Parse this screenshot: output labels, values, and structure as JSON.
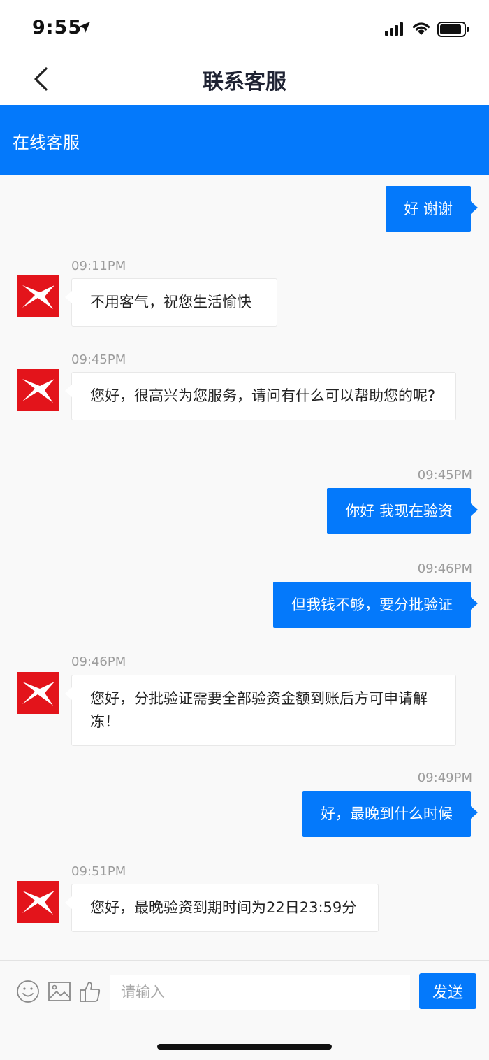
{
  "status_bar": {
    "time": "9:55",
    "icons": [
      "location-arrow-icon",
      "signal-icon",
      "wifi-icon",
      "battery-icon"
    ]
  },
  "nav": {
    "title": "联系客服",
    "back_icon": "chevron-left-icon"
  },
  "service_bar": {
    "label": "在线客服"
  },
  "messages": [
    {
      "side": "out",
      "time": "",
      "text": "好 谢谢"
    },
    {
      "side": "in",
      "time": "09:11PM",
      "text": "不用客气，祝您生活愉快"
    },
    {
      "side": "in",
      "time": "09:45PM",
      "text": "您好，很高兴为您服务，请问有什么可以帮助您的呢?"
    },
    {
      "side": "out",
      "time": "09:45PM",
      "text": "你好 我现在验资"
    },
    {
      "side": "out",
      "time": "09:46PM",
      "text": "但我钱不够，要分批验证"
    },
    {
      "side": "in",
      "time": "09:46PM",
      "text": "您好，分批验证需要全部验资金额到账后方可申请解冻！"
    },
    {
      "side": "out",
      "time": "09:49PM",
      "text": "好，最晚到什么时候"
    },
    {
      "side": "in",
      "time": "09:51PM",
      "text": "您好，最晚验资到期时间为22日23:59分"
    }
  ],
  "input": {
    "placeholder": "请输入",
    "value": "",
    "send_label": "发送",
    "tools": [
      "emoji-icon",
      "image-icon",
      "thumbs-up-icon"
    ]
  },
  "colors": {
    "accent": "#0479fb",
    "avatar": "#e3141b",
    "background": "#f9f9f9"
  }
}
